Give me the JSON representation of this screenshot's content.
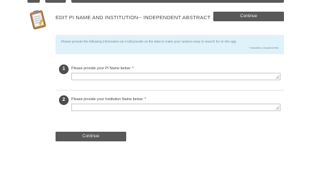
{
  "header": {
    "title": "EDIT PI NAME AND INSTITUTION-- INDEPENDENT ABSTRACT ...",
    "continue_label": "Continue",
    "icon": "clipboard-icon"
  },
  "info": {
    "message": "Please provide the following information as it will provide us the data to make your session easy to search for on the app.",
    "required_note": "* indicates a required field"
  },
  "questions": [
    {
      "number": "1",
      "label": "Please provide your PI Name below: *",
      "value": ""
    },
    {
      "number": "2",
      "label": "Please provide your Institution Name below: *",
      "value": ""
    }
  ],
  "footer": {
    "continue_label": "Continue"
  },
  "colors": {
    "button": "#595959",
    "info_bg": "#dff1f9",
    "badge": "#4d4d4d"
  }
}
